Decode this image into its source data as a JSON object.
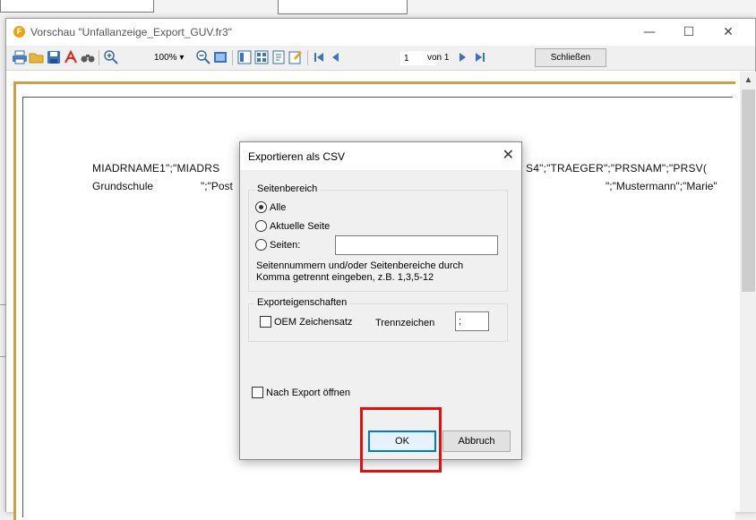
{
  "window": {
    "title": "Vorschau \"Unfallanzeige_Export_GUV.fr3\"",
    "minimize": "—",
    "maximize": "☐",
    "close": "✕"
  },
  "toolbar": {
    "zoom": "100%",
    "zoom_arrow": "▾",
    "page_value": "1",
    "of_pages": "von 1",
    "close_label": "Schließen"
  },
  "report": {
    "header": "MIADRNAME1\";\"MIADRS",
    "header_right": "S4\";\"TRAEGER\";\"PRSNAM\";\"PRSV(",
    "row_left": "Grundschule",
    "row_mid": "\";\"Post",
    "row_right": "\";\"Mustermann\";\"Marie\""
  },
  "dialog": {
    "title": "Exportieren als CSV",
    "close": "✕",
    "page_range": {
      "legend": "Seitenbereich",
      "options": [
        "Alle",
        "Aktuelle Seite",
        "Seiten:"
      ],
      "selected": "Alle",
      "pages_value": "",
      "hint_line1": "Seitennummern und/oder Seitenbereiche durch",
      "hint_line2": "Komma getrennt eingeben, z.B. 1,3,5-12"
    },
    "export_props": {
      "legend": "Exporteigenschaften",
      "oem_label": "OEM Zeichensatz",
      "separator_label": "Trennzeichen",
      "separator_value": ";"
    },
    "open_after_label": "Nach Export öffnen",
    "ok_label": "OK",
    "cancel_label": "Abbruch"
  },
  "colors": {
    "highlight": "#e01010",
    "page_border": "#c8a14a",
    "accent": "#0078d7"
  }
}
